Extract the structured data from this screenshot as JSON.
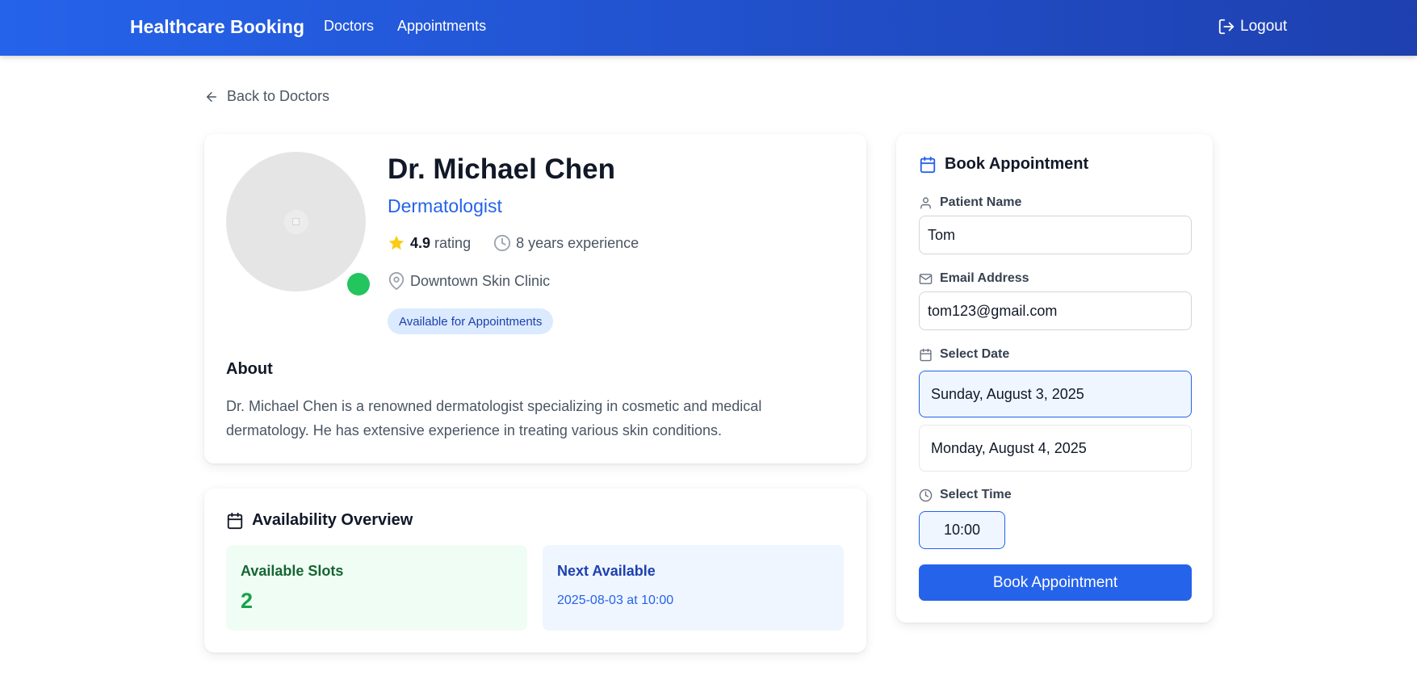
{
  "nav": {
    "brand": "Healthcare Booking",
    "links": [
      "Doctors",
      "Appointments"
    ],
    "logout": "Logout"
  },
  "back_link": "Back to Doctors",
  "doctor": {
    "name": "Dr. Michael Chen",
    "specialty": "Dermatologist",
    "rating": "4.9",
    "rating_label": "rating",
    "experience": "8 years experience",
    "location": "Downtown Skin Clinic",
    "status": "Available for Appointments",
    "online": true
  },
  "about": {
    "title": "About",
    "text": "Dr. Michael Chen is a renowned dermatologist specializing in cosmetic and medical dermatology. He has extensive experience in treating various skin conditions."
  },
  "availability": {
    "title": "Availability Overview",
    "slots_label": "Available Slots",
    "slots_value": "2",
    "next_label": "Next Available",
    "next_value": "2025-08-03 at 10:00"
  },
  "booking": {
    "title": "Book Appointment",
    "patient_label": "Patient Name",
    "patient_value": "Tom",
    "email_label": "Email Address",
    "email_value": "tom123@gmail.com",
    "date_label": "Select Date",
    "dates": [
      "Sunday, August 3, 2025",
      "Monday, August 4, 2025"
    ],
    "selected_date_index": 0,
    "time_label": "Select Time",
    "times": [
      "10:00"
    ],
    "button": "Book Appointment"
  },
  "colors": {
    "primary": "#2563eb",
    "nav_gradient_end": "#1e40af",
    "success": "#22c55e",
    "star": "#facc15"
  }
}
